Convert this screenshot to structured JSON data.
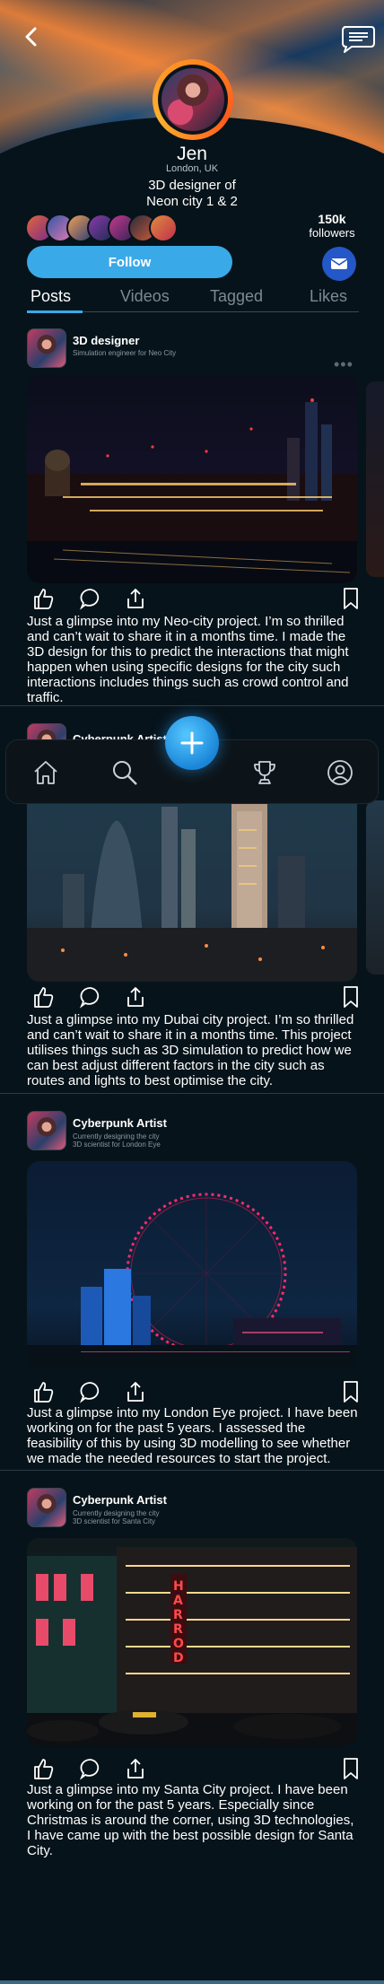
{
  "profile": {
    "name": "Jen",
    "location": "London, UK",
    "bio_line1": "3D designer of",
    "bio_line2": "Neon city 1 & 2",
    "followers_count": "150k",
    "followers_label": "followers",
    "follow_label": "Follow"
  },
  "tabs": [
    {
      "label": "Posts",
      "active": true
    },
    {
      "label": "Videos",
      "active": false
    },
    {
      "label": "Tagged",
      "active": false
    },
    {
      "label": "Likes",
      "active": false
    }
  ],
  "posts": [
    {
      "title": "3D designer",
      "subtitle1": "Simulation engineer for Neo City",
      "subtitle2": "",
      "text": "Just a glimpse into my Neo-city project. I’m so thrilled and can’t wait to share it in a months time. I made the 3D design for this to predict the interactions that might happen when using specific designs for the city such interactions includes things such as crowd control and traffic."
    },
    {
      "title": "Cyberpunk Artist",
      "subtitle1": "",
      "subtitle2": "",
      "text": "Just a glimpse into my Dubai city project. I’m so thrilled and can’t wait to share it in a months time. This project utilises things such as 3D simulation to predict how we can best adjust different factors in the city such as routes and lights to best optimise the city."
    },
    {
      "title": "Cyberpunk Artist",
      "subtitle1": "Currently designing the city",
      "subtitle2": "3D scientist for London Eye",
      "text": "Just a glimpse into my London Eye project. I have been working on for the past 5 years. I assessed the feasibility of this by using 3D modelling to see whether we made the needed resources to start the project."
    },
    {
      "title": "Cyberpunk Artist",
      "subtitle1": "Currently designing the city",
      "subtitle2": "3D scientist for Santa City",
      "text": "Just a glimpse into my Santa City project. I have been working on for the past 5 years. Especially since Christmas is around the corner, using 3D technologies, I have came up with the best possible design for Santa City."
    }
  ],
  "icons": {
    "back": "chevron-left-icon",
    "chat": "chat-bubble-icon",
    "mail": "mail-icon",
    "like": "thumbs-up-icon",
    "comment": "comment-icon",
    "share": "share-icon",
    "bookmark": "bookmark-icon",
    "home": "home-icon",
    "search": "search-icon",
    "add": "plus-icon",
    "trophy": "trophy-icon",
    "profile": "user-icon"
  },
  "colors": {
    "accent": "#3aa9e8",
    "mail": "#2457c7",
    "ring": "#ff8a1f",
    "background": "#07131a"
  }
}
